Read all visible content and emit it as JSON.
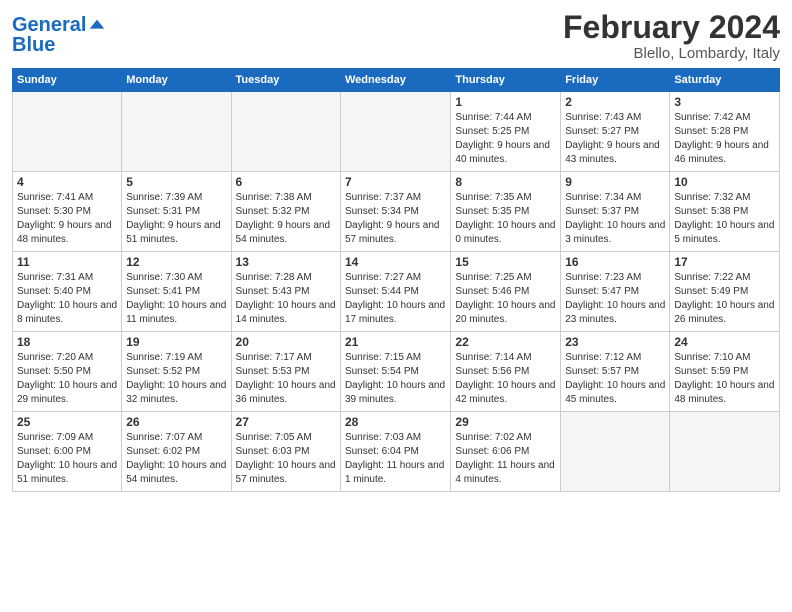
{
  "header": {
    "logo_line1": "General",
    "logo_line2": "Blue",
    "month": "February 2024",
    "location": "Blello, Lombardy, Italy"
  },
  "weekdays": [
    "Sunday",
    "Monday",
    "Tuesday",
    "Wednesday",
    "Thursday",
    "Friday",
    "Saturday"
  ],
  "weeks": [
    [
      {
        "day": "",
        "info": ""
      },
      {
        "day": "",
        "info": ""
      },
      {
        "day": "",
        "info": ""
      },
      {
        "day": "",
        "info": ""
      },
      {
        "day": "1",
        "info": "Sunrise: 7:44 AM\nSunset: 5:25 PM\nDaylight: 9 hours\nand 40 minutes."
      },
      {
        "day": "2",
        "info": "Sunrise: 7:43 AM\nSunset: 5:27 PM\nDaylight: 9 hours\nand 43 minutes."
      },
      {
        "day": "3",
        "info": "Sunrise: 7:42 AM\nSunset: 5:28 PM\nDaylight: 9 hours\nand 46 minutes."
      }
    ],
    [
      {
        "day": "4",
        "info": "Sunrise: 7:41 AM\nSunset: 5:30 PM\nDaylight: 9 hours\nand 48 minutes."
      },
      {
        "day": "5",
        "info": "Sunrise: 7:39 AM\nSunset: 5:31 PM\nDaylight: 9 hours\nand 51 minutes."
      },
      {
        "day": "6",
        "info": "Sunrise: 7:38 AM\nSunset: 5:32 PM\nDaylight: 9 hours\nand 54 minutes."
      },
      {
        "day": "7",
        "info": "Sunrise: 7:37 AM\nSunset: 5:34 PM\nDaylight: 9 hours\nand 57 minutes."
      },
      {
        "day": "8",
        "info": "Sunrise: 7:35 AM\nSunset: 5:35 PM\nDaylight: 10 hours\nand 0 minutes."
      },
      {
        "day": "9",
        "info": "Sunrise: 7:34 AM\nSunset: 5:37 PM\nDaylight: 10 hours\nand 3 minutes."
      },
      {
        "day": "10",
        "info": "Sunrise: 7:32 AM\nSunset: 5:38 PM\nDaylight: 10 hours\nand 5 minutes."
      }
    ],
    [
      {
        "day": "11",
        "info": "Sunrise: 7:31 AM\nSunset: 5:40 PM\nDaylight: 10 hours\nand 8 minutes."
      },
      {
        "day": "12",
        "info": "Sunrise: 7:30 AM\nSunset: 5:41 PM\nDaylight: 10 hours\nand 11 minutes."
      },
      {
        "day": "13",
        "info": "Sunrise: 7:28 AM\nSunset: 5:43 PM\nDaylight: 10 hours\nand 14 minutes."
      },
      {
        "day": "14",
        "info": "Sunrise: 7:27 AM\nSunset: 5:44 PM\nDaylight: 10 hours\nand 17 minutes."
      },
      {
        "day": "15",
        "info": "Sunrise: 7:25 AM\nSunset: 5:46 PM\nDaylight: 10 hours\nand 20 minutes."
      },
      {
        "day": "16",
        "info": "Sunrise: 7:23 AM\nSunset: 5:47 PM\nDaylight: 10 hours\nand 23 minutes."
      },
      {
        "day": "17",
        "info": "Sunrise: 7:22 AM\nSunset: 5:49 PM\nDaylight: 10 hours\nand 26 minutes."
      }
    ],
    [
      {
        "day": "18",
        "info": "Sunrise: 7:20 AM\nSunset: 5:50 PM\nDaylight: 10 hours\nand 29 minutes."
      },
      {
        "day": "19",
        "info": "Sunrise: 7:19 AM\nSunset: 5:52 PM\nDaylight: 10 hours\nand 32 minutes."
      },
      {
        "day": "20",
        "info": "Sunrise: 7:17 AM\nSunset: 5:53 PM\nDaylight: 10 hours\nand 36 minutes."
      },
      {
        "day": "21",
        "info": "Sunrise: 7:15 AM\nSunset: 5:54 PM\nDaylight: 10 hours\nand 39 minutes."
      },
      {
        "day": "22",
        "info": "Sunrise: 7:14 AM\nSunset: 5:56 PM\nDaylight: 10 hours\nand 42 minutes."
      },
      {
        "day": "23",
        "info": "Sunrise: 7:12 AM\nSunset: 5:57 PM\nDaylight: 10 hours\nand 45 minutes."
      },
      {
        "day": "24",
        "info": "Sunrise: 7:10 AM\nSunset: 5:59 PM\nDaylight: 10 hours\nand 48 minutes."
      }
    ],
    [
      {
        "day": "25",
        "info": "Sunrise: 7:09 AM\nSunset: 6:00 PM\nDaylight: 10 hours\nand 51 minutes."
      },
      {
        "day": "26",
        "info": "Sunrise: 7:07 AM\nSunset: 6:02 PM\nDaylight: 10 hours\nand 54 minutes."
      },
      {
        "day": "27",
        "info": "Sunrise: 7:05 AM\nSunset: 6:03 PM\nDaylight: 10 hours\nand 57 minutes."
      },
      {
        "day": "28",
        "info": "Sunrise: 7:03 AM\nSunset: 6:04 PM\nDaylight: 11 hours\nand 1 minute."
      },
      {
        "day": "29",
        "info": "Sunrise: 7:02 AM\nSunset: 6:06 PM\nDaylight: 11 hours\nand 4 minutes."
      },
      {
        "day": "",
        "info": ""
      },
      {
        "day": "",
        "info": ""
      }
    ]
  ]
}
